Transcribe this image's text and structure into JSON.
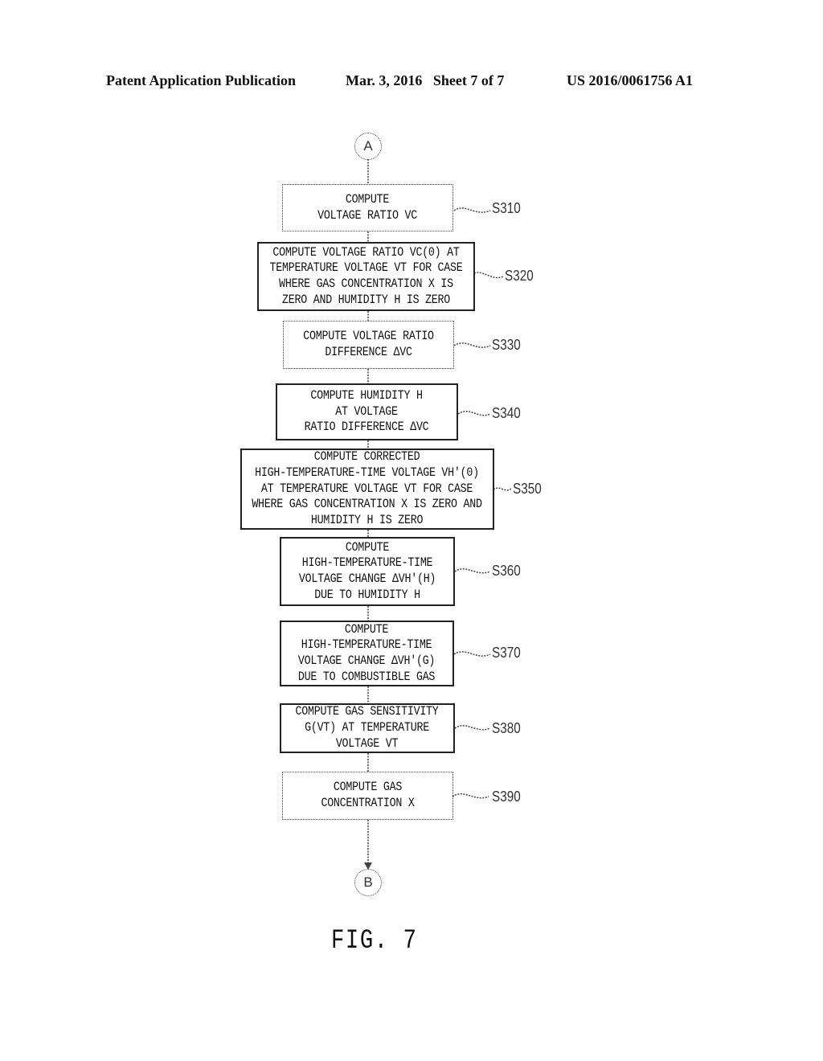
{
  "header": {
    "left": "Patent Application Publication",
    "middle": "Mar. 3, 2016   Sheet 7 of 7",
    "right": "US 2016/0061756 A1"
  },
  "connectors": {
    "start": "A",
    "end": "B"
  },
  "steps": [
    {
      "id": "S310",
      "text": "COMPUTE\nVOLTAGE RATIO VC"
    },
    {
      "id": "S320",
      "text": "COMPUTE VOLTAGE RATIO VC(0) AT\nTEMPERATURE VOLTAGE VT FOR CASE\nWHERE GAS CONCENTRATION X IS\nZERO AND HUMIDITY H IS ZERO"
    },
    {
      "id": "S330",
      "text": "COMPUTE VOLTAGE RATIO\nDIFFERENCE ΔVC"
    },
    {
      "id": "S340",
      "text": "COMPUTE HUMIDITY H\nAT VOLTAGE\nRATIO DIFFERENCE ΔVC"
    },
    {
      "id": "S350",
      "text": "COMPUTE CORRECTED\nHIGH-TEMPERATURE-TIME VOLTAGE VH'(0)\nAT TEMPERATURE VOLTAGE VT FOR CASE\nWHERE GAS CONCENTRATION X IS ZERO AND\nHUMIDITY H IS ZERO"
    },
    {
      "id": "S360",
      "text": "COMPUTE\nHIGH-TEMPERATURE-TIME\nVOLTAGE CHANGE ΔVH'(H)\nDUE TO HUMIDITY H"
    },
    {
      "id": "S370",
      "text": "COMPUTE\nHIGH-TEMPERATURE-TIME\nVOLTAGE CHANGE ΔVH'(G)\nDUE TO COMBUSTIBLE GAS"
    },
    {
      "id": "S380",
      "text": "COMPUTE GAS SENSITIVITY\nG(VT) AT TEMPERATURE\nVOLTAGE VT"
    },
    {
      "id": "S390",
      "text": "COMPUTE GAS\nCONCENTRATION X"
    }
  ],
  "figure_label": "FIG. 7"
}
